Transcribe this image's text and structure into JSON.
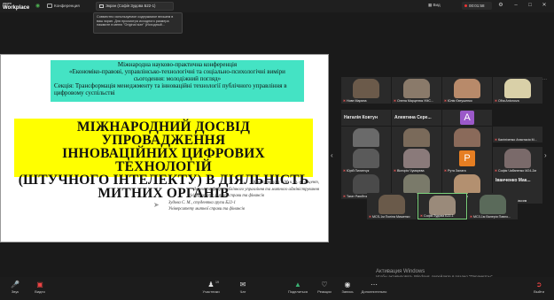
{
  "topbar": {
    "brand_small": "zoom",
    "brand_big": "Workplace",
    "conference_label": "Конференция",
    "screen_pill": "Экран (Софія Зудова Б22-1)",
    "view_label": "Вид",
    "rec_label": "00:01:58",
    "colors": {
      "accent": "#4caf50",
      "record": "#ee3333"
    }
  },
  "tooltip": {
    "text": "Совместно используемое содержимое впишем в ваш экран. Для просмотра исходного размера нажмите в меню \"Original size\" (Исходный..."
  },
  "slide": {
    "header_lines": [
      "Міжнародна науково-практична конференція",
      "«Економіко-правові, управлінсько-технологічні та соціально-психологічні виміри",
      "сьогодення: молодіжний погляд»"
    ],
    "section_lines": [
      "Секція: Трансформація менеджменту та інноваційні технології публічного управління в",
      "цифровому суспільстві"
    ],
    "title_lines": [
      "МІЖНАРОДНИЙ ДОСВІД УПРОВАДЖЕННЯ",
      "ІННОВАЦІЙНИХ ЦИФРОВИХ ТЕХНОЛОГІЙ",
      "(ШТУЧНОГО ІНТЕЛЕКТУ) В ДІЯЛЬНІСТЬ",
      "МИТНИХ ОРГАНІВ"
    ],
    "author_lines": [
      "Каросттеліна І. М. к. ю. н., доцент,",
      "доцент кафедри публічного управління та митного адміністрування",
      "Університету митної справи та фінансів",
      "Зудова С. М., студентка групи Б22-1",
      "Університету митної справи та фінансів"
    ],
    "colors": {
      "header_bg": "#44e3c4",
      "title_bg": "#ffff00"
    }
  },
  "gallery": {
    "tiles": [
      {
        "name": "Нове Марина",
        "kind": "face",
        "color": "#6b5a4a"
      },
      {
        "name": "Олена Марценюк УМС...",
        "kind": "face",
        "color": "#8a7a6a"
      },
      {
        "name": "Юлія Євтушенко",
        "kind": "face",
        "color": "#b88a6a"
      },
      {
        "name": "Olha Antonova",
        "kind": "face",
        "color": "#d9d0a8"
      },
      {
        "name": "Наталія Ковтун",
        "kind": "big"
      },
      {
        "name": "Алевтина Сере...",
        "kind": "big"
      },
      {
        "name": "A",
        "kind": "avatar",
        "color": "#9b59c9"
      },
      {
        "name": "Наталія Ковтун",
        "kind": "face",
        "color": "#6a6a6a"
      },
      {
        "name": "ЛюбомирОметус",
        "kind": "face",
        "color": "#7a6a5a"
      },
      {
        "name": "Алевтина Сереба (Брез...",
        "kind": "face",
        "color": "#8a6a5a"
      },
      {
        "name": "Калініченко Анастасія М...",
        "kind": "text"
      },
      {
        "name": "Юрій Пилипчук",
        "kind": "face",
        "color": "#5a5a5a"
      },
      {
        "name": "Вікторія Чумарєва",
        "kind": "face",
        "color": "#8a7a7a"
      },
      {
        "name": "Рута Залата",
        "kind": "avatar",
        "color": "#e67e22",
        "letter": "P"
      },
      {
        "name": "Софія Чабаненко М24-2м",
        "kind": "face",
        "color": "#7a6a6a"
      },
      {
        "name": "Тагат Раюбтом",
        "kind": "face",
        "color": "#4a4a4a"
      },
      {
        "name": "Віра Петрук",
        "kind": "face",
        "color": "#7a7a6a"
      },
      {
        "name": "Бондар Ксенія МСЗ-1м",
        "kind": "face",
        "color": "#b39070"
      },
      {
        "name": "Іванченко Мак...",
        "kind": "big"
      },
      {
        "name": "Іваниченко Максим",
        "kind": "text"
      },
      {
        "name": "MCS-1м Поліна Мишенко",
        "kind": "face",
        "color": "#6a5a4a"
      },
      {
        "name": "Софія Зудова Б22-1",
        "kind": "face",
        "color": "#9a8a7a"
      },
      {
        "name": "МСЗ-1м Валерія Павло...",
        "kind": "face",
        "color": "#5a6a5a"
      }
    ]
  },
  "toolbar": {
    "mic_label": "Звук",
    "video_label": "Видео",
    "participants_label": "Участники",
    "participants_count": "19",
    "chat_label": "Чат",
    "share_label": "Поделиться",
    "reactions_label": "Реакции",
    "record_label": "Запись",
    "more_label": "Дополнительно",
    "leave_label": "Выйти"
  },
  "windows_activation": {
    "title": "Активация Windows",
    "subtitle": "Чтобы активировать Windows, перейдите в раздел \"Параметры\"."
  }
}
